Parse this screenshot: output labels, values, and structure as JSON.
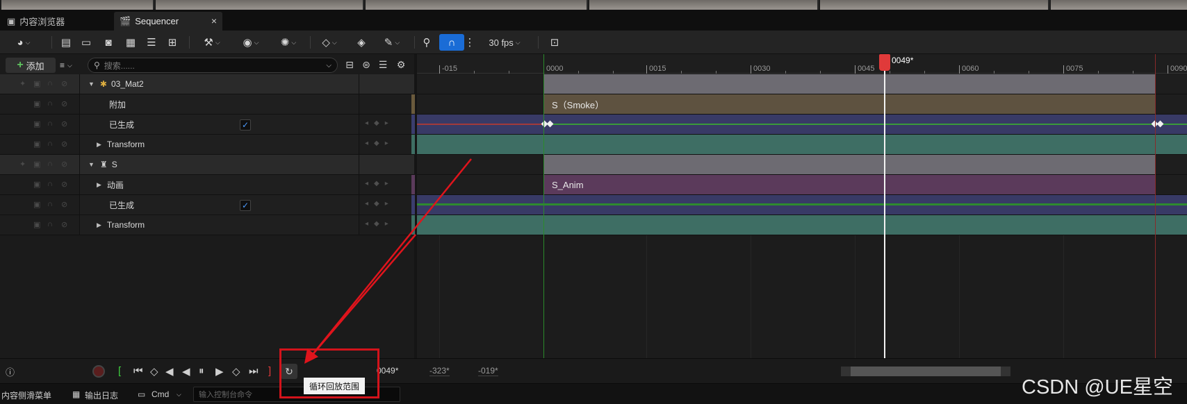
{
  "tabs": {
    "content_browser": "内容浏览器",
    "sequencer": "Sequencer",
    "close_glyph": "×"
  },
  "toolbar": {
    "fps": "30 fps",
    "snap_glyph": "∩"
  },
  "left_panel": {
    "add_label": "添加",
    "search_placeholder": "搜索......"
  },
  "tracks": [
    {
      "label": "03_Mat2",
      "kind": "header"
    },
    {
      "label": "附加",
      "kind": "sub"
    },
    {
      "label": "已生成",
      "kind": "sub",
      "checked": true
    },
    {
      "label": "Transform",
      "kind": "sub-expandable"
    },
    {
      "label": "S",
      "kind": "header"
    },
    {
      "label": "动画",
      "kind": "sub-expandable"
    },
    {
      "label": "已生成",
      "kind": "sub",
      "checked": true
    },
    {
      "label": "Transform",
      "kind": "sub-expandable"
    }
  ],
  "timeline": {
    "ruler_labels": [
      "-015",
      "0000",
      "0015",
      "0030",
      "0045",
      "0060",
      "0075",
      "0090"
    ],
    "playhead": "0049*",
    "sections": {
      "smoke": "S（Smoke）",
      "anim": "S_Anim"
    },
    "colors": {
      "header_bar": "#6d6b72",
      "smoke": "#5e5240",
      "blue_track": "#383a66",
      "transform": "#3e6e64",
      "anim": "#5b3a5b"
    }
  },
  "transport": {
    "current_frame": "0049*",
    "range_start": "-323*",
    "range_end": "-019*"
  },
  "tooltip": "循环回放范围",
  "status_bar": {
    "content_drawer": "内容侧滑菜单",
    "output_log": "输出日志",
    "cmd": "Cmd",
    "console_placeholder": "输入控制台命令"
  },
  "watermark": "CSDN @UE星空"
}
